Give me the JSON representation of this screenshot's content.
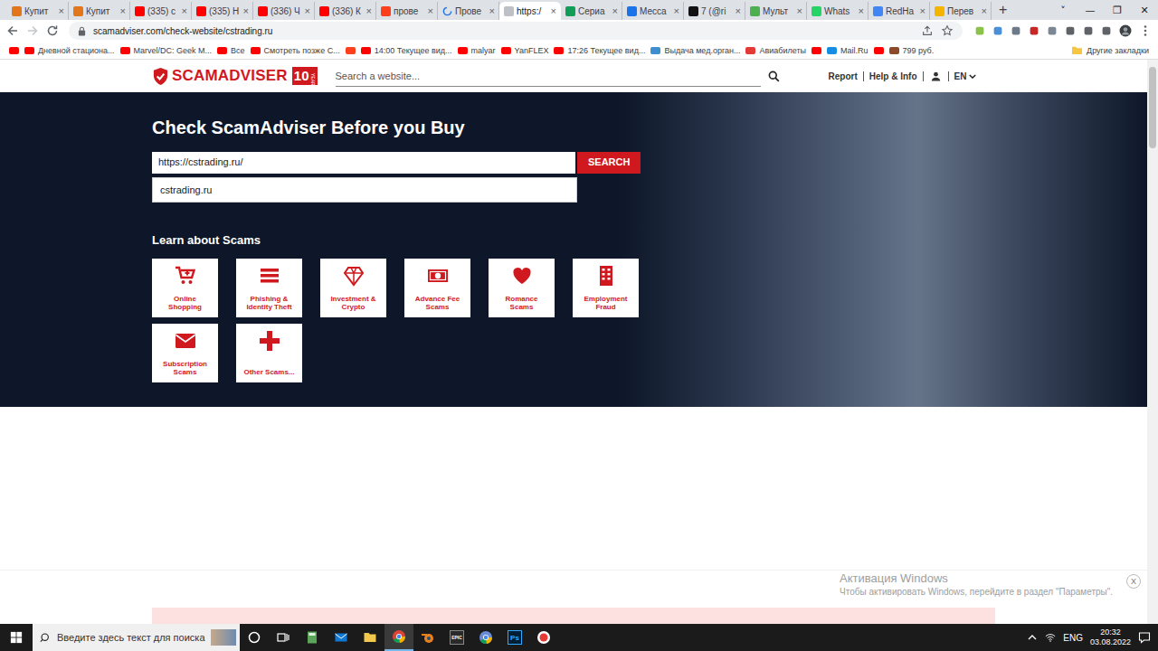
{
  "browser": {
    "tabs": [
      {
        "label": "Купит",
        "selected": false,
        "loading": false,
        "color": "#e2761b"
      },
      {
        "label": "Купит",
        "selected": false,
        "loading": false,
        "color": "#e2761b"
      },
      {
        "label": "(335) с",
        "selected": false,
        "loading": false,
        "color": "#ff0000"
      },
      {
        "label": "(335) Н",
        "selected": false,
        "loading": false,
        "color": "#ff0000"
      },
      {
        "label": "(336) Ч",
        "selected": false,
        "loading": false,
        "color": "#ff0000"
      },
      {
        "label": "(336) К",
        "selected": false,
        "loading": false,
        "color": "#ff0000"
      },
      {
        "label": "прове",
        "selected": false,
        "loading": false,
        "color": "#fc3f1d"
      },
      {
        "label": "Прове",
        "selected": false,
        "loading": true,
        "color": "#1a73e8"
      },
      {
        "label": "https:/",
        "selected": true,
        "loading": false,
        "color": "#bdc1c6"
      },
      {
        "label": "Сериа",
        "selected": false,
        "loading": false,
        "color": "#0f9d58"
      },
      {
        "label": "Месса",
        "selected": false,
        "loading": false,
        "color": "#1a73e8"
      },
      {
        "label": "7 (@ri",
        "selected": false,
        "loading": false,
        "color": "#111111"
      },
      {
        "label": "Мульт",
        "selected": false,
        "loading": false,
        "color": "#4caf50"
      },
      {
        "label": "Whats",
        "selected": false,
        "loading": false,
        "color": "#25d366"
      },
      {
        "label": "RedHa",
        "selected": false,
        "loading": false,
        "color": "#4285f4"
      },
      {
        "label": "Перев",
        "selected": false,
        "loading": false,
        "color": "#f4b400"
      }
    ],
    "tab_close": "×",
    "new_tab": "+",
    "window_controls": [
      "˅",
      "—",
      "❐",
      "✕"
    ]
  },
  "address_bar": {
    "url": "scamadviser.com/check-website/cstrading.ru"
  },
  "bookmarks": [
    {
      "kind": "icon",
      "color": "#ff0000"
    },
    {
      "kind": "link",
      "label": "Дневной стациона...",
      "color": "#ff0000"
    },
    {
      "kind": "link",
      "label": "Marvel/DC: Geek M...",
      "color": "#ff0000"
    },
    {
      "kind": "link",
      "label": "Все",
      "color": "#ff0000"
    },
    {
      "kind": "link",
      "label": "Смотреть позже С...",
      "color": "#ff0000"
    },
    {
      "kind": "icon",
      "color": "#fc3f1d"
    },
    {
      "kind": "link",
      "label": "14:00 Текущее вид...",
      "color": "#ff0000"
    },
    {
      "kind": "link",
      "label": "malyar",
      "color": "#ff0000"
    },
    {
      "kind": "link",
      "label": "YanFLEX",
      "color": "#ff0000"
    },
    {
      "kind": "link",
      "label": "17:26 Текущее вид...",
      "color": "#ff0000"
    },
    {
      "kind": "link",
      "label": "Выдача мед.орган...",
      "color": "#3d8fd1"
    },
    {
      "kind": "link",
      "label": "Авиабилеты",
      "color": "#e53935"
    },
    {
      "kind": "icon",
      "color": "#ff0000"
    },
    {
      "kind": "link",
      "label": "Mail.Ru",
      "color": "#168de2"
    },
    {
      "kind": "icon",
      "color": "#ff0000"
    },
    {
      "kind": "link",
      "label": "799 руб.",
      "color": "#8d4a2b"
    }
  ],
  "other_bookmarks": "Другие закладки",
  "page": {
    "header": {
      "logo": "SCAMADVISER",
      "badge_number": "10",
      "badge_text": "YEARS",
      "search_placeholder": "Search a website...",
      "links": [
        "Report",
        "Help & Info"
      ],
      "language": "EN"
    },
    "hero": {
      "title": "Check ScamAdviser Before you Buy",
      "search_value": "https://cstrading.ru/",
      "search_button": "SEARCH",
      "suggestions": [
        "cstrading.ru"
      ],
      "section_title": "Learn about Scams",
      "tiles": [
        {
          "label": "Online Shopping"
        },
        {
          "label": "Phishing & Identity Theft"
        },
        {
          "label": "Investment & Crypto"
        },
        {
          "label": "Advance Fee Scams"
        },
        {
          "label": "Romance Scams"
        },
        {
          "label": "Employment Fraud"
        },
        {
          "label": "Subscription Scams"
        },
        {
          "label": "Other Scams..."
        }
      ]
    },
    "ad_banner": {
      "close": "X"
    }
  },
  "watermark": {
    "title": "Активация Windows",
    "text": "Чтобы активировать Windows, перейдите в раздел \"Параметры\"."
  },
  "taskbar": {
    "search_placeholder": "Введите здесь текст для поиска",
    "apps": [
      {
        "kind": "cortana",
        "active": false
      },
      {
        "kind": "taskview",
        "active": false
      },
      {
        "kind": "calculator",
        "active": false
      },
      {
        "kind": "mail",
        "active": false
      },
      {
        "kind": "explorer",
        "active": false
      },
      {
        "kind": "chrome",
        "active": true
      },
      {
        "kind": "blender",
        "active": false
      },
      {
        "kind": "epic",
        "glyph": "EPIC",
        "active": false
      },
      {
        "kind": "chrome-alt",
        "active": false
      },
      {
        "kind": "photoshop",
        "glyph": "Ps",
        "active": false
      },
      {
        "kind": "record",
        "active": false
      }
    ],
    "language": "ENG",
    "time": "20:32",
    "date": "03.08.2022"
  }
}
